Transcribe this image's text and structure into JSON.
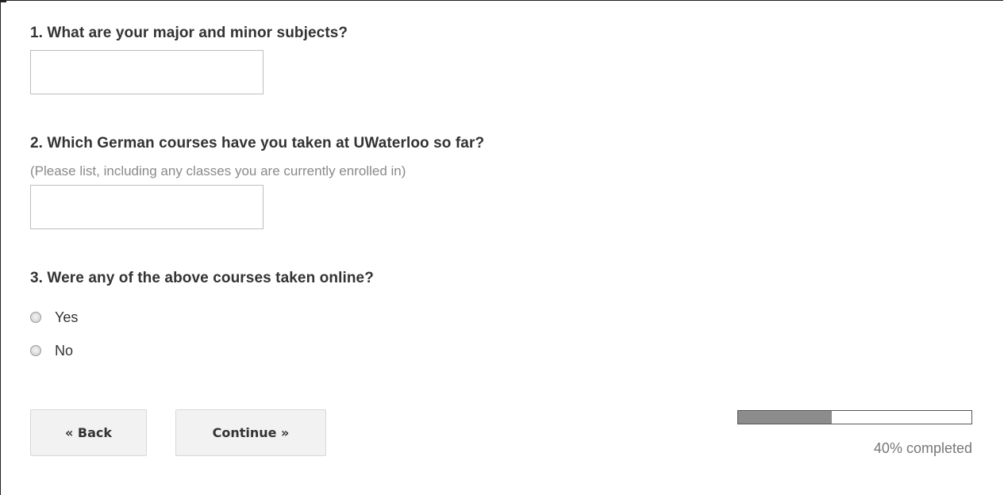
{
  "questions": [
    {
      "title": "1. What are your major and minor subjects?",
      "value": ""
    },
    {
      "title": "2. Which German courses have you taken at UWaterloo so far?",
      "hint": "(Please list, including any classes you are currently enrolled in)",
      "value": ""
    },
    {
      "title": "3. Were any of the above courses taken online?",
      "options": [
        "Yes",
        "No"
      ]
    }
  ],
  "nav": {
    "back_label": "« Back",
    "continue_label": "Continue »"
  },
  "progress": {
    "fraction": 0.4,
    "label": "40% completed"
  }
}
